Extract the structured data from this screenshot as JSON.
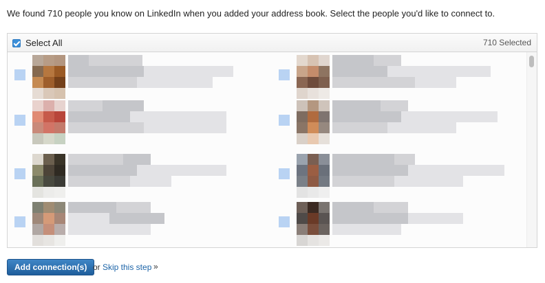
{
  "intro": "We found 710 people you know on LinkedIn when you added your address book. Select the people you'd like to connect to.",
  "panel": {
    "select_all_label": "Select All",
    "selected_count": "710 Selected"
  },
  "actions": {
    "add_button": "Add connection(s)",
    "or_text": "or",
    "skip_link": "Skip this step",
    "skip_suffix": "»"
  },
  "colors": {
    "link": "#1c64a8",
    "button": "#2a6fb0",
    "checkbox": "#3b8fd9"
  }
}
